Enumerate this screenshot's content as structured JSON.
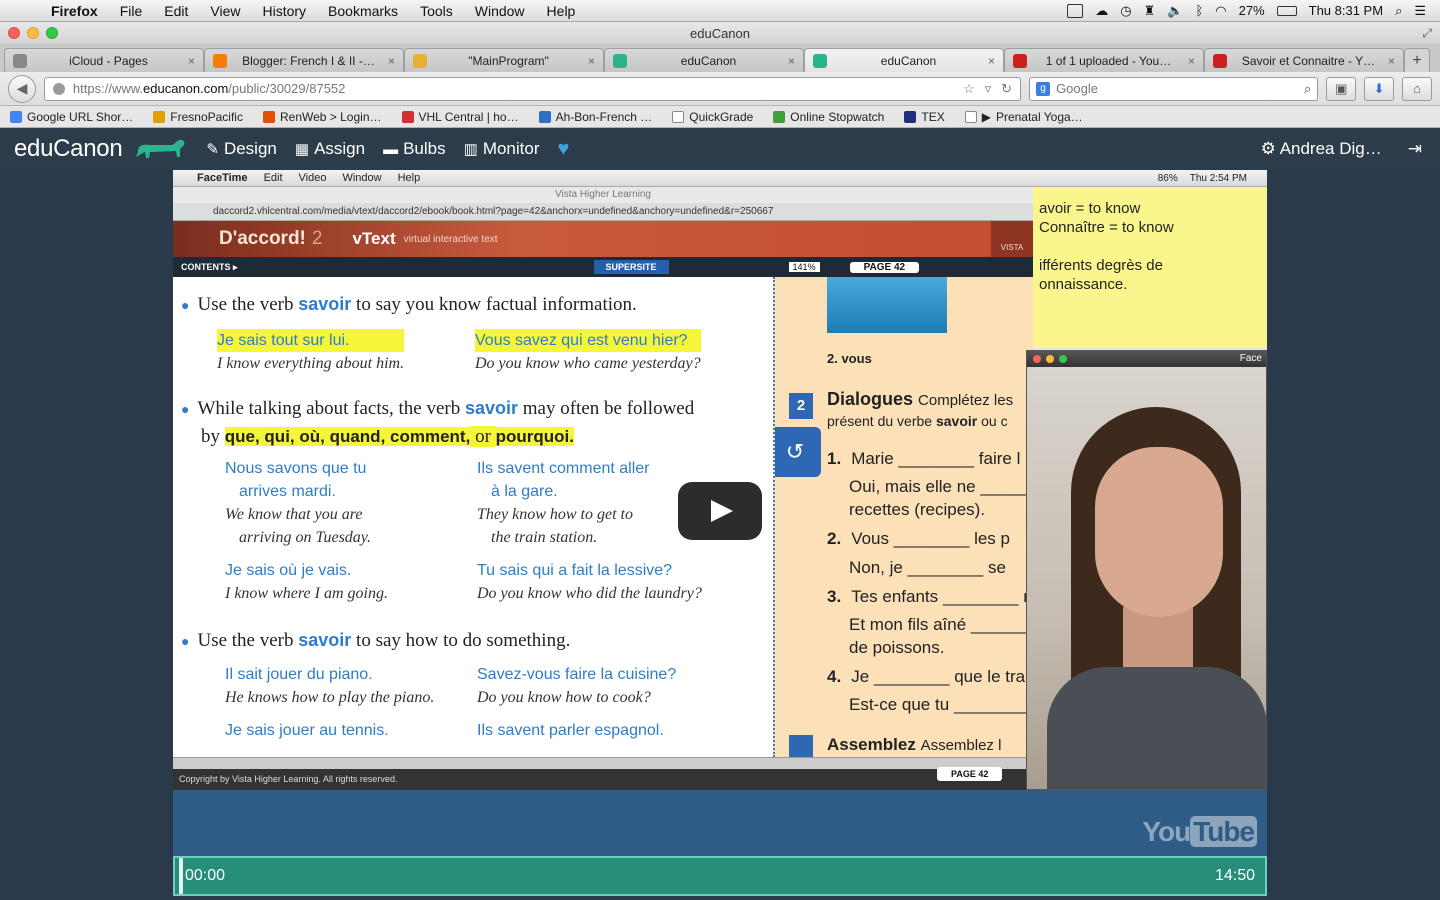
{
  "menubar": {
    "app": "Firefox",
    "items": [
      "File",
      "Edit",
      "View",
      "History",
      "Bookmarks",
      "Tools",
      "Window",
      "Help"
    ],
    "battery": "27%",
    "clock": "Thu 8:31 PM"
  },
  "window": {
    "title": "eduCanon"
  },
  "tabs": [
    {
      "label": "iCloud - Pages",
      "color": "#888888"
    },
    {
      "label": "Blogger: French I & II -…",
      "color": "#f57d00"
    },
    {
      "label": "\"MainProgram\"",
      "color": "#e8b030"
    },
    {
      "label": "eduCanon",
      "color": "#2bb58f"
    },
    {
      "label": "eduCanon",
      "color": "#2bb58f",
      "active": true
    },
    {
      "label": "1 of 1 uploaded - You…",
      "color": "#cc1f1f"
    },
    {
      "label": "Savoir et Connaitre - Y…",
      "color": "#cc1f1f"
    }
  ],
  "navbar": {
    "url_prefix": "https://www.",
    "url_host": "educanon.com",
    "url_path": "/public/30029/87552",
    "search_placeholder": "Google"
  },
  "bookmarks": [
    {
      "label": "Google URL Shor…",
      "color": "#4285f4"
    },
    {
      "label": "FresnoPacific",
      "color": "#e0a000"
    },
    {
      "label": "RenWeb > Login…",
      "color": "#e05000"
    },
    {
      "label": "VHL Central | ho…",
      "color": "#d03030"
    },
    {
      "label": "Ah-Bon-French …",
      "color": "#3070c0"
    },
    {
      "label": "QuickGrade",
      "color": "#ffffff"
    },
    {
      "label": "Online Stopwatch",
      "color": "#40a040"
    },
    {
      "label": "TEX",
      "color": "#203080"
    },
    {
      "label": "Prenatal Yoga…",
      "color": "#ffffff"
    }
  ],
  "educanon": {
    "logo": "eduCanon",
    "nav": [
      {
        "label": "Design",
        "glyph": "✎"
      },
      {
        "label": "Assign",
        "glyph": "▦"
      },
      {
        "label": "Bulbs",
        "glyph": "▬"
      },
      {
        "label": "Monitor",
        "glyph": "▥"
      }
    ],
    "user": "Andrea Dig…"
  },
  "video": {
    "inner_menu": {
      "app": "FaceTime",
      "items": [
        "Edit",
        "Video",
        "Window",
        "Help"
      ],
      "battery": "86%",
      "clock": "Thu 2:54 PM"
    },
    "inner_title": "Vista Higher Learning",
    "inner_url": "daccord2.vhlcentral.com/media/vtext/daccord2/ebook/book.html?page=42&anchorx=undefined&anchory=undefined&r=250667",
    "book_brand": "D'accord!",
    "book_num": "2",
    "vtext": "vText",
    "vtext_sub": "virtual interactive text",
    "vista": "VISTA",
    "contents": "CONTENTS ▸",
    "supersite": "SUPERSITE",
    "zoom": "141%",
    "page": "PAGE 42",
    "copyright": "Copyright  by Vista Higher Learning. All rights reserved.",
    "bullets": [
      {
        "pre": "Use the verb ",
        "kw": "savoir",
        "post": " to say you know factual information."
      },
      {
        "pre": "While talking about facts, the verb ",
        "kw": "savoir",
        "post": " may often be followed"
      },
      {
        "pre": "Use the verb ",
        "kw": "savoir",
        "post": " to say how to do something."
      }
    ],
    "bullet2_by": "by ",
    "bullet2_hl": "que, qui, où, quand, comment,",
    "bullet2_or": " or ",
    "bullet2_last": "pourquoi.",
    "examples": {
      "e1_fr": "Je sais tout sur lui.",
      "e1_en": "I know everything about him.",
      "e2_fr": "Vous savez qui est venu hier?",
      "e2_en": "Do you know who came yesterday?",
      "e3_fr1": "Nous savons que tu",
      "e3_fr2": "arrives mardi.",
      "e3_en1": "We know that you are",
      "e3_en2": "arriving on Tuesday.",
      "e4_fr1": "Ils savent comment aller",
      "e4_fr2": "à la gare.",
      "e4_en1": "They know how to get to",
      "e4_en2": "the train station.",
      "e5_fr": "Je sais où je vais.",
      "e5_en": "I know where I am going.",
      "e6_fr": "Tu sais qui a fait la lessive?",
      "e6_en": "Do you know who did the laundry?",
      "e7_fr": "Il sait jouer du piano.",
      "e7_en": "He knows how to play the piano.",
      "e8_fr": "Savez-vous faire la cuisine?",
      "e8_en": "Do you know how to cook?",
      "e9_fr": "Je sais jouer au tennis.",
      "e10_fr": "Ils savent parler espagnol."
    },
    "right_page": {
      "label": "2. vous",
      "num2": "2",
      "dialogues": "Dialogues",
      "dialogues_sub": "Complétez les",
      "present": "présent du verbe ",
      "present_bold": "savoir",
      "present_end": " ou c",
      "lines": [
        {
          "n": "1.",
          "t": "Marie ________ faire l"
        },
        {
          "n": "",
          "t": "Oui, mais elle ne ______"
        },
        {
          "n": "",
          "t": "recettes (recipes)."
        },
        {
          "n": "2.",
          "t": "Vous ________ les p"
        },
        {
          "n": "",
          "t": "Non, je ________ se"
        },
        {
          "n": "3.",
          "t": "Tes enfants ________ n"
        },
        {
          "n": "",
          "t": "Et mon fils aîné ______"
        },
        {
          "n": "",
          "t": "de poissons."
        },
        {
          "n": "4.",
          "t": "Je ________ que le train"
        },
        {
          "n": "",
          "t": "Est-ce que tu ________ à"
        }
      ],
      "assemblez": "Assemblez",
      "assemblez_sub": "Assemblez l"
    },
    "sticky": {
      "l1": "avoir = to know",
      "l2": "Connaître = to know",
      "l3": "ifférents degrès de",
      "l4": "onnaissance."
    },
    "facetime_label": "Face",
    "youtube_you": "You",
    "youtube_tube": "Tube"
  },
  "timeline": {
    "start": "00:00",
    "end": "14:50",
    "progress": 0
  }
}
